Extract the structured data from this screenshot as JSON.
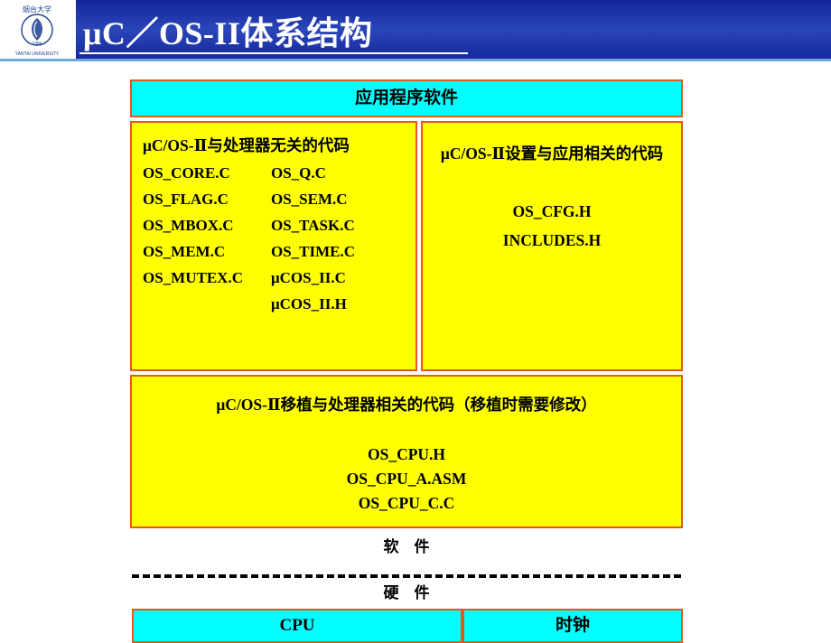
{
  "header": {
    "title": "μC／OS-II体系结构",
    "logo_name": "yantai-university-logo",
    "logo_text_top": "烟台大学",
    "logo_year": "1984",
    "logo_text_bottom": "YANTAI UNIVERSITY",
    "bg_color": "#1b35a0"
  },
  "diagram": {
    "app_box": {
      "label": "应用程序软件",
      "fill": "#00ffff",
      "border": "#e8561b"
    },
    "core_box": {
      "title": "μC/OS-Ⅱ与处理器无关的代码",
      "fill": "#ffff00",
      "border": "#e8561b",
      "files": [
        [
          "OS_CORE.C",
          "OS_Q.C"
        ],
        [
          "OS_FLAG.C",
          "OS_SEM.C"
        ],
        [
          "OS_MBOX.C",
          "OS_TASK.C"
        ],
        [
          "OS_MEM.C",
          "OS_TIME.C"
        ],
        [
          "OS_MUTEX.C",
          "μCOS_II.C"
        ],
        [
          "",
          "μCOS_II.H"
        ]
      ]
    },
    "cfg_box": {
      "title": "μC/OS-Ⅱ设置与应用相关的代码",
      "fill": "#ffff00",
      "border": "#e8561b",
      "files": [
        "OS_CFG.H",
        "INCLUDES.H"
      ]
    },
    "port_box": {
      "title": "μC/OS-Ⅱ移植与处理器相关的代码（移植时需要修改）",
      "fill": "#ffff00",
      "border": "#e8561b",
      "files": [
        "OS_CPU.H",
        "OS_CPU_A.ASM",
        "OS_CPU_C.C"
      ]
    },
    "software_label": "软　件",
    "hardware_label": "硬　件",
    "cpu_box": {
      "label": "CPU",
      "fill": "#00ffff",
      "border": "#e8561b"
    },
    "clock_box": {
      "label": "时钟",
      "fill": "#00ffff",
      "border": "#e8561b"
    }
  }
}
